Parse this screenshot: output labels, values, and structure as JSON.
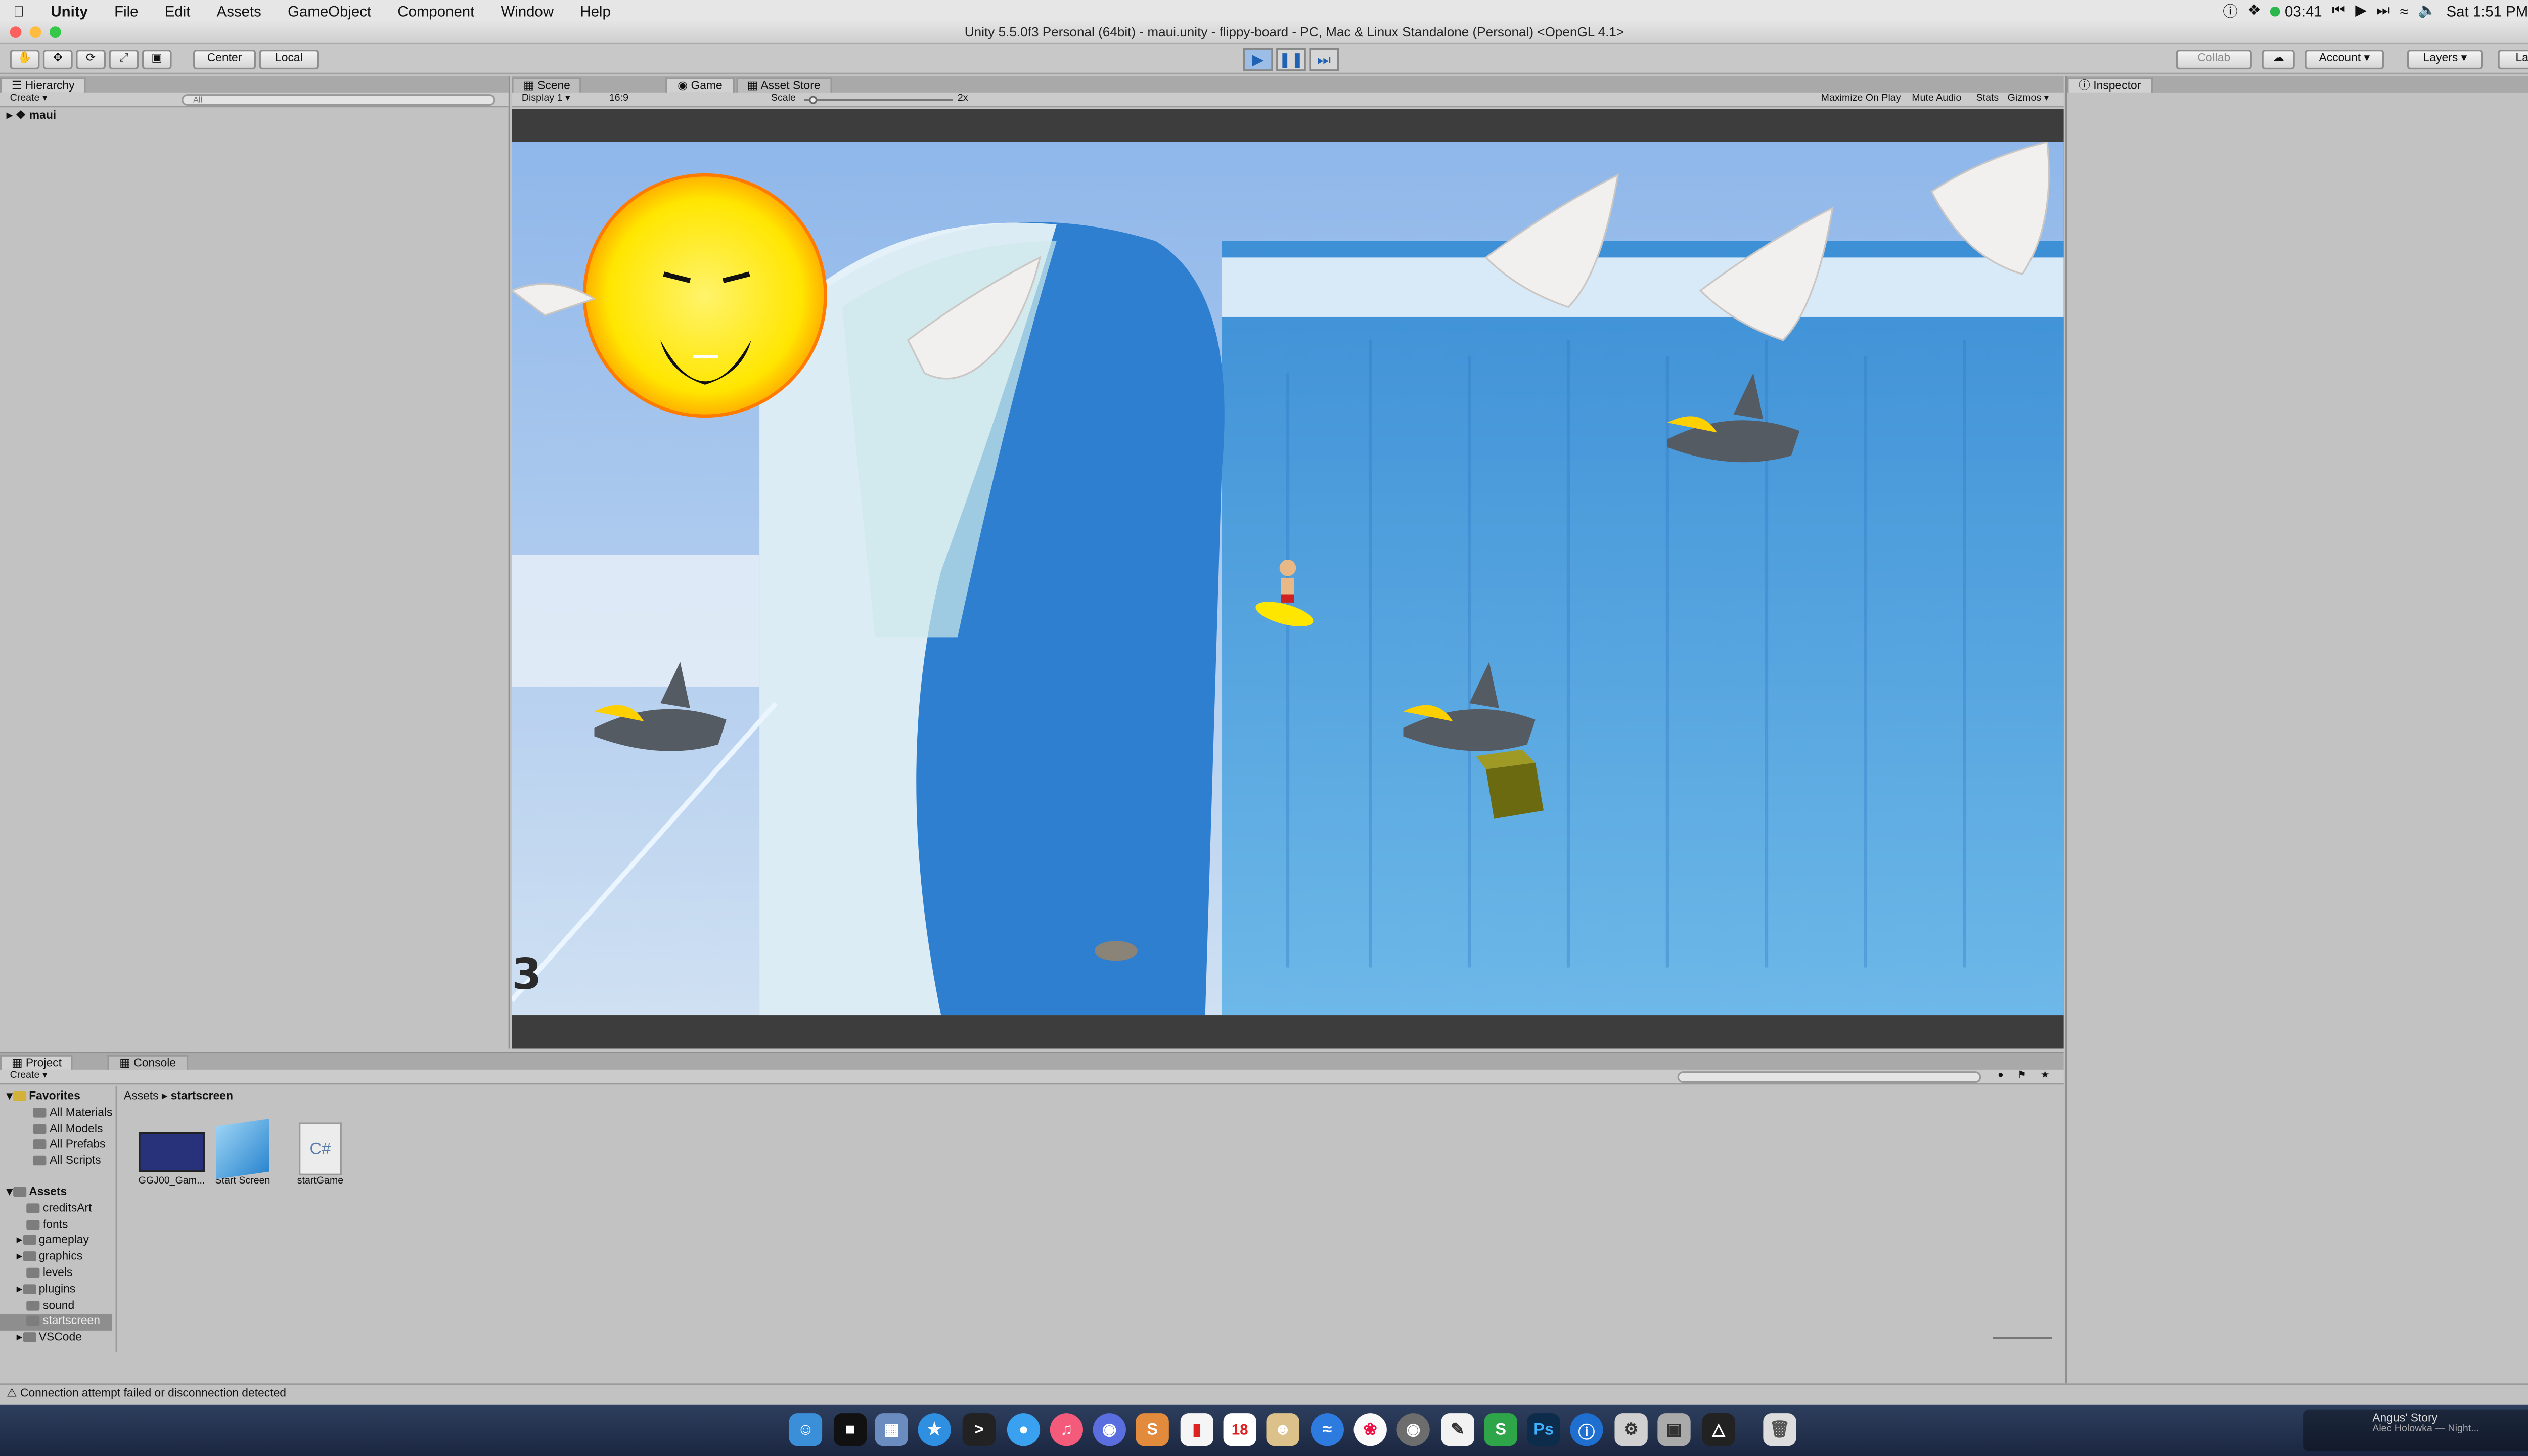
{
  "menubar": {
    "apple_icon": "apple-icon",
    "app": "Unity",
    "items": [
      "File",
      "Edit",
      "Assets",
      "GameObject",
      "Component",
      "Window",
      "Help"
    ],
    "timer": "03:41",
    "clock": "Sat 1:51 PM"
  },
  "window": {
    "title": "Unity 5.5.0f3 Personal (64bit) - maui.unity - flippy-board - PC, Mac & Linux Standalone (Personal) <OpenGL 4.1>"
  },
  "toolbar": {
    "pivot": "Center",
    "space": "Local",
    "collab": "Collab",
    "account": "Account",
    "layers": "Layers",
    "layout": "Layout"
  },
  "hierarchy": {
    "tab": "Hierarchy",
    "create": "Create",
    "search_placeholder": "All",
    "scene": "maui"
  },
  "game_view": {
    "tabs": [
      "Scene",
      "Game",
      "Asset Store"
    ],
    "display": "Display 1",
    "aspect": "16:9",
    "scale_label": "Scale",
    "scale_value": "2x",
    "scale_fraction": 0.05,
    "options": [
      "Maximize On Play",
      "Mute Audio",
      "Stats",
      "Gizmos"
    ],
    "score": "3"
  },
  "inspector": {
    "tab": "Inspector"
  },
  "project": {
    "tabs": [
      "Project",
      "Console"
    ],
    "create": "Create",
    "favorites_label": "Favorites",
    "favorites": [
      "All Materials",
      "All Models",
      "All Prefabs",
      "All Scripts"
    ],
    "assets_label": "Assets",
    "folders": [
      "creditsArt",
      "fonts",
      "gameplay",
      "graphics",
      "levels",
      "plugins",
      "sound",
      "startscreen",
      "VSCode"
    ],
    "breadcrumb": [
      "Assets",
      "startscreen"
    ],
    "files": [
      "GGJ00_Gam...",
      "Start Screen",
      "startGame"
    ],
    "file_icon_text": "C#"
  },
  "status": {
    "message": "Connection attempt failed or disconnection detected"
  },
  "dock": {
    "now_playing_title": "Angus' Story",
    "now_playing_artist": "Alec Holowka — Night...",
    "calendar_day": "18",
    "ps_label": "Ps"
  },
  "colors": {
    "play_active": "#9cbde6",
    "selection": "#8e8e8e",
    "sky": "#8fb7ea",
    "wave": "#4aa3df",
    "sun": "#ffe600"
  }
}
